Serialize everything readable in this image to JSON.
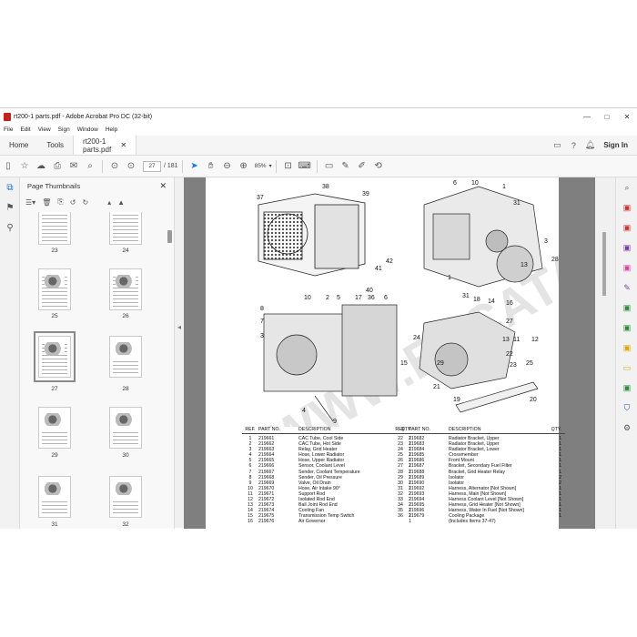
{
  "window": {
    "title": "rt200-1 parts.pdf - Adobe Acrobat Pro DC (32-bit)",
    "controls": [
      "—",
      "□",
      "✕"
    ]
  },
  "menu": [
    "File",
    "Edit",
    "View",
    "Sign",
    "Window",
    "Help"
  ],
  "tabs": {
    "home": "Home",
    "tools": "Tools",
    "document": "rt200-1 parts.pdf",
    "close": "✕",
    "sign_in": "Sign In"
  },
  "toolbar": {
    "current_page": "27",
    "total_pages": "/ 181",
    "zoom": "85%"
  },
  "thumbnail_panel": {
    "title": "Page Thumbnails",
    "close": "✕",
    "thumbnails": [
      {
        "label": "23"
      },
      {
        "label": "24"
      },
      {
        "label": "25"
      },
      {
        "label": "26"
      },
      {
        "label": "27"
      },
      {
        "label": "28"
      },
      {
        "label": "29"
      },
      {
        "label": "30"
      },
      {
        "label": "31"
      },
      {
        "label": "32"
      }
    ]
  },
  "diagram_callouts": [
    "38",
    "39",
    "37",
    "42",
    "41",
    "40",
    "6",
    "10",
    "1",
    "31",
    "3",
    "28",
    "13",
    "1",
    "31",
    "18",
    "14",
    "16",
    "10",
    "5",
    "2",
    "17",
    "36",
    "6",
    "8",
    "7",
    "3",
    "15",
    "4",
    "9",
    "27",
    "24",
    "11",
    "12",
    "13",
    "22",
    "23",
    "25",
    "29",
    "21",
    "19",
    "20"
  ],
  "parts_table": {
    "headers": {
      "ref": "REF.",
      "part": "PART NO.",
      "desc": "DESCRIPTION",
      "qty": "QTY."
    },
    "left": [
      {
        "ref": "1",
        "part": "219661",
        "desc": "CAC Tube, Cool Side",
        "qty": "1"
      },
      {
        "ref": "2",
        "part": "219662",
        "desc": "CAC Tube, Hot Side",
        "qty": "1"
      },
      {
        "ref": "3",
        "part": "219663",
        "desc": "Relay, Grid Heater",
        "qty": "1"
      },
      {
        "ref": "4",
        "part": "219664",
        "desc": "Hose, Lower Radiator",
        "qty": "1"
      },
      {
        "ref": "5",
        "part": "219665",
        "desc": "Hose, Upper Radiator",
        "qty": "1"
      },
      {
        "ref": "6",
        "part": "219666",
        "desc": "Sensor, Coolant Level",
        "qty": "1"
      },
      {
        "ref": "7",
        "part": "219667",
        "desc": "Sender, Coolant Temperature",
        "qty": "1"
      },
      {
        "ref": "8",
        "part": "219668",
        "desc": "Sender, Oil Pressure",
        "qty": "1"
      },
      {
        "ref": "9",
        "part": "219669",
        "desc": "Valve, Oil Drain",
        "qty": "1"
      },
      {
        "ref": "10",
        "part": "219670",
        "desc": "Hose, Air Intake 90°",
        "qty": "1"
      },
      {
        "ref": "11",
        "part": "219671",
        "desc": "Support Rod",
        "qty": "2"
      },
      {
        "ref": "12",
        "part": "219672",
        "desc": "Isolated Rod End",
        "qty": "2"
      },
      {
        "ref": "13",
        "part": "219673",
        "desc": "Ball Joint Rod End",
        "qty": "2"
      },
      {
        "ref": "14",
        "part": "219674",
        "desc": "Cooling Fan",
        "qty": "1"
      },
      {
        "ref": "15",
        "part": "219675",
        "desc": "Transmission Temp Switch",
        "qty": "1"
      },
      {
        "ref": "16",
        "part": "219676",
        "desc": "Air Governor",
        "qty": "1"
      }
    ],
    "right": [
      {
        "ref": "22",
        "part": "219682",
        "desc": "Radiator Bracket, Upper",
        "qty": "1"
      },
      {
        "ref": "23",
        "part": "219683",
        "desc": "Radiator Bracket, Upper",
        "qty": "1"
      },
      {
        "ref": "24",
        "part": "219684",
        "desc": "Radiator Bracket, Lower",
        "qty": "1"
      },
      {
        "ref": "25",
        "part": "219685",
        "desc": "Crossmember",
        "qty": "1"
      },
      {
        "ref": "26",
        "part": "219686",
        "desc": "Front Mount",
        "qty": "1"
      },
      {
        "ref": "27",
        "part": "219687",
        "desc": "Bracket, Secondary Fuel Filter",
        "qty": "1"
      },
      {
        "ref": "28",
        "part": "219688",
        "desc": "Bracket, Grid Heater Relay",
        "qty": "1"
      },
      {
        "ref": "29",
        "part": "219689",
        "desc": "Isolator",
        "qty": "2"
      },
      {
        "ref": "30",
        "part": "219690",
        "desc": "Isolator",
        "qty": "2"
      },
      {
        "ref": "31",
        "part": "219692",
        "desc": "Harness, Alternator [Not Shown]",
        "qty": "1"
      },
      {
        "ref": "32",
        "part": "219693",
        "desc": "Harness, Main [Not Shown]",
        "qty": "1"
      },
      {
        "ref": "33",
        "part": "219694",
        "desc": "Harness Coolant Level [Not Shown]",
        "qty": "1"
      },
      {
        "ref": "34",
        "part": "219695",
        "desc": "Harness, Grid Heater [Not Shown]",
        "qty": "1"
      },
      {
        "ref": "35",
        "part": "219696",
        "desc": "Harness, Water In Fuel [Not Shown]",
        "qty": "1"
      },
      {
        "ref": "36",
        "part": "219679",
        "desc": "Cooling Package",
        "qty": "1"
      },
      {
        "ref": "",
        "part": "",
        "desc": "(Includes Items 37-47)",
        "qty": ""
      }
    ]
  },
  "watermark_text": "WWW.EPCATALOGS.COM"
}
